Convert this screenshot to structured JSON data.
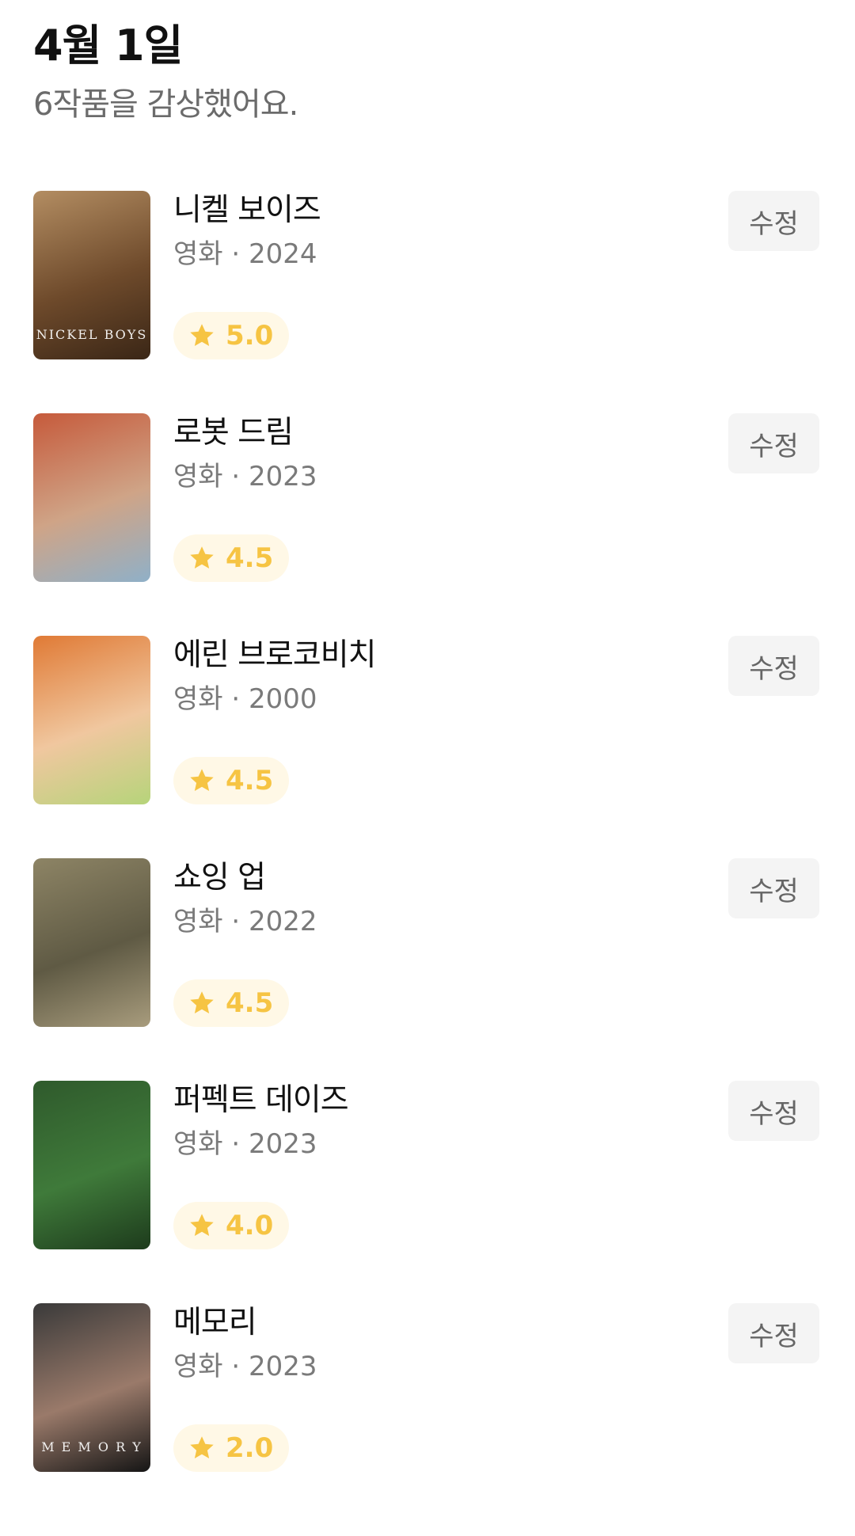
{
  "header": {
    "date": "4월 1일",
    "summary": "6작품을 감상했어요."
  },
  "colors": {
    "rating_bg": "#fff8e6",
    "rating_accent": "#f6c443",
    "edit_bg": "#f4f4f4"
  },
  "items": [
    {
      "title": "니켈 보이즈",
      "meta": "영화 · 2024",
      "rating": "5.0",
      "edit_label": "수정",
      "poster_text": "NICKEL BOYS",
      "poster_colors": [
        "#b38d62",
        "#6e4a2b",
        "#3a2616"
      ]
    },
    {
      "title": "로봇 드림",
      "meta": "영화 · 2023",
      "rating": "4.5",
      "edit_label": "수정",
      "poster_text": "",
      "poster_colors": [
        "#c65a3b",
        "#cfa487",
        "#8fb0c8"
      ]
    },
    {
      "title": "에린 브로코비치",
      "meta": "영화 · 2000",
      "rating": "4.5",
      "edit_label": "수정",
      "poster_text": "",
      "poster_colors": [
        "#e07a35",
        "#f0c79f",
        "#b6d47a"
      ]
    },
    {
      "title": "쇼잉 업",
      "meta": "영화 · 2022",
      "rating": "4.5",
      "edit_label": "수정",
      "poster_text": "",
      "poster_colors": [
        "#8d8465",
        "#5f5a44",
        "#a89c7d"
      ]
    },
    {
      "title": "퍼펙트 데이즈",
      "meta": "영화 · 2023",
      "rating": "4.0",
      "edit_label": "수정",
      "poster_text": "",
      "poster_colors": [
        "#2f5a2c",
        "#3f7a3a",
        "#1d3b1c"
      ]
    },
    {
      "title": "메모리",
      "meta": "영화 · 2023",
      "rating": "2.0",
      "edit_label": "수정",
      "poster_text": "M E M O R Y",
      "poster_colors": [
        "#3a3a3a",
        "#9a7a6a",
        "#151515"
      ]
    }
  ]
}
